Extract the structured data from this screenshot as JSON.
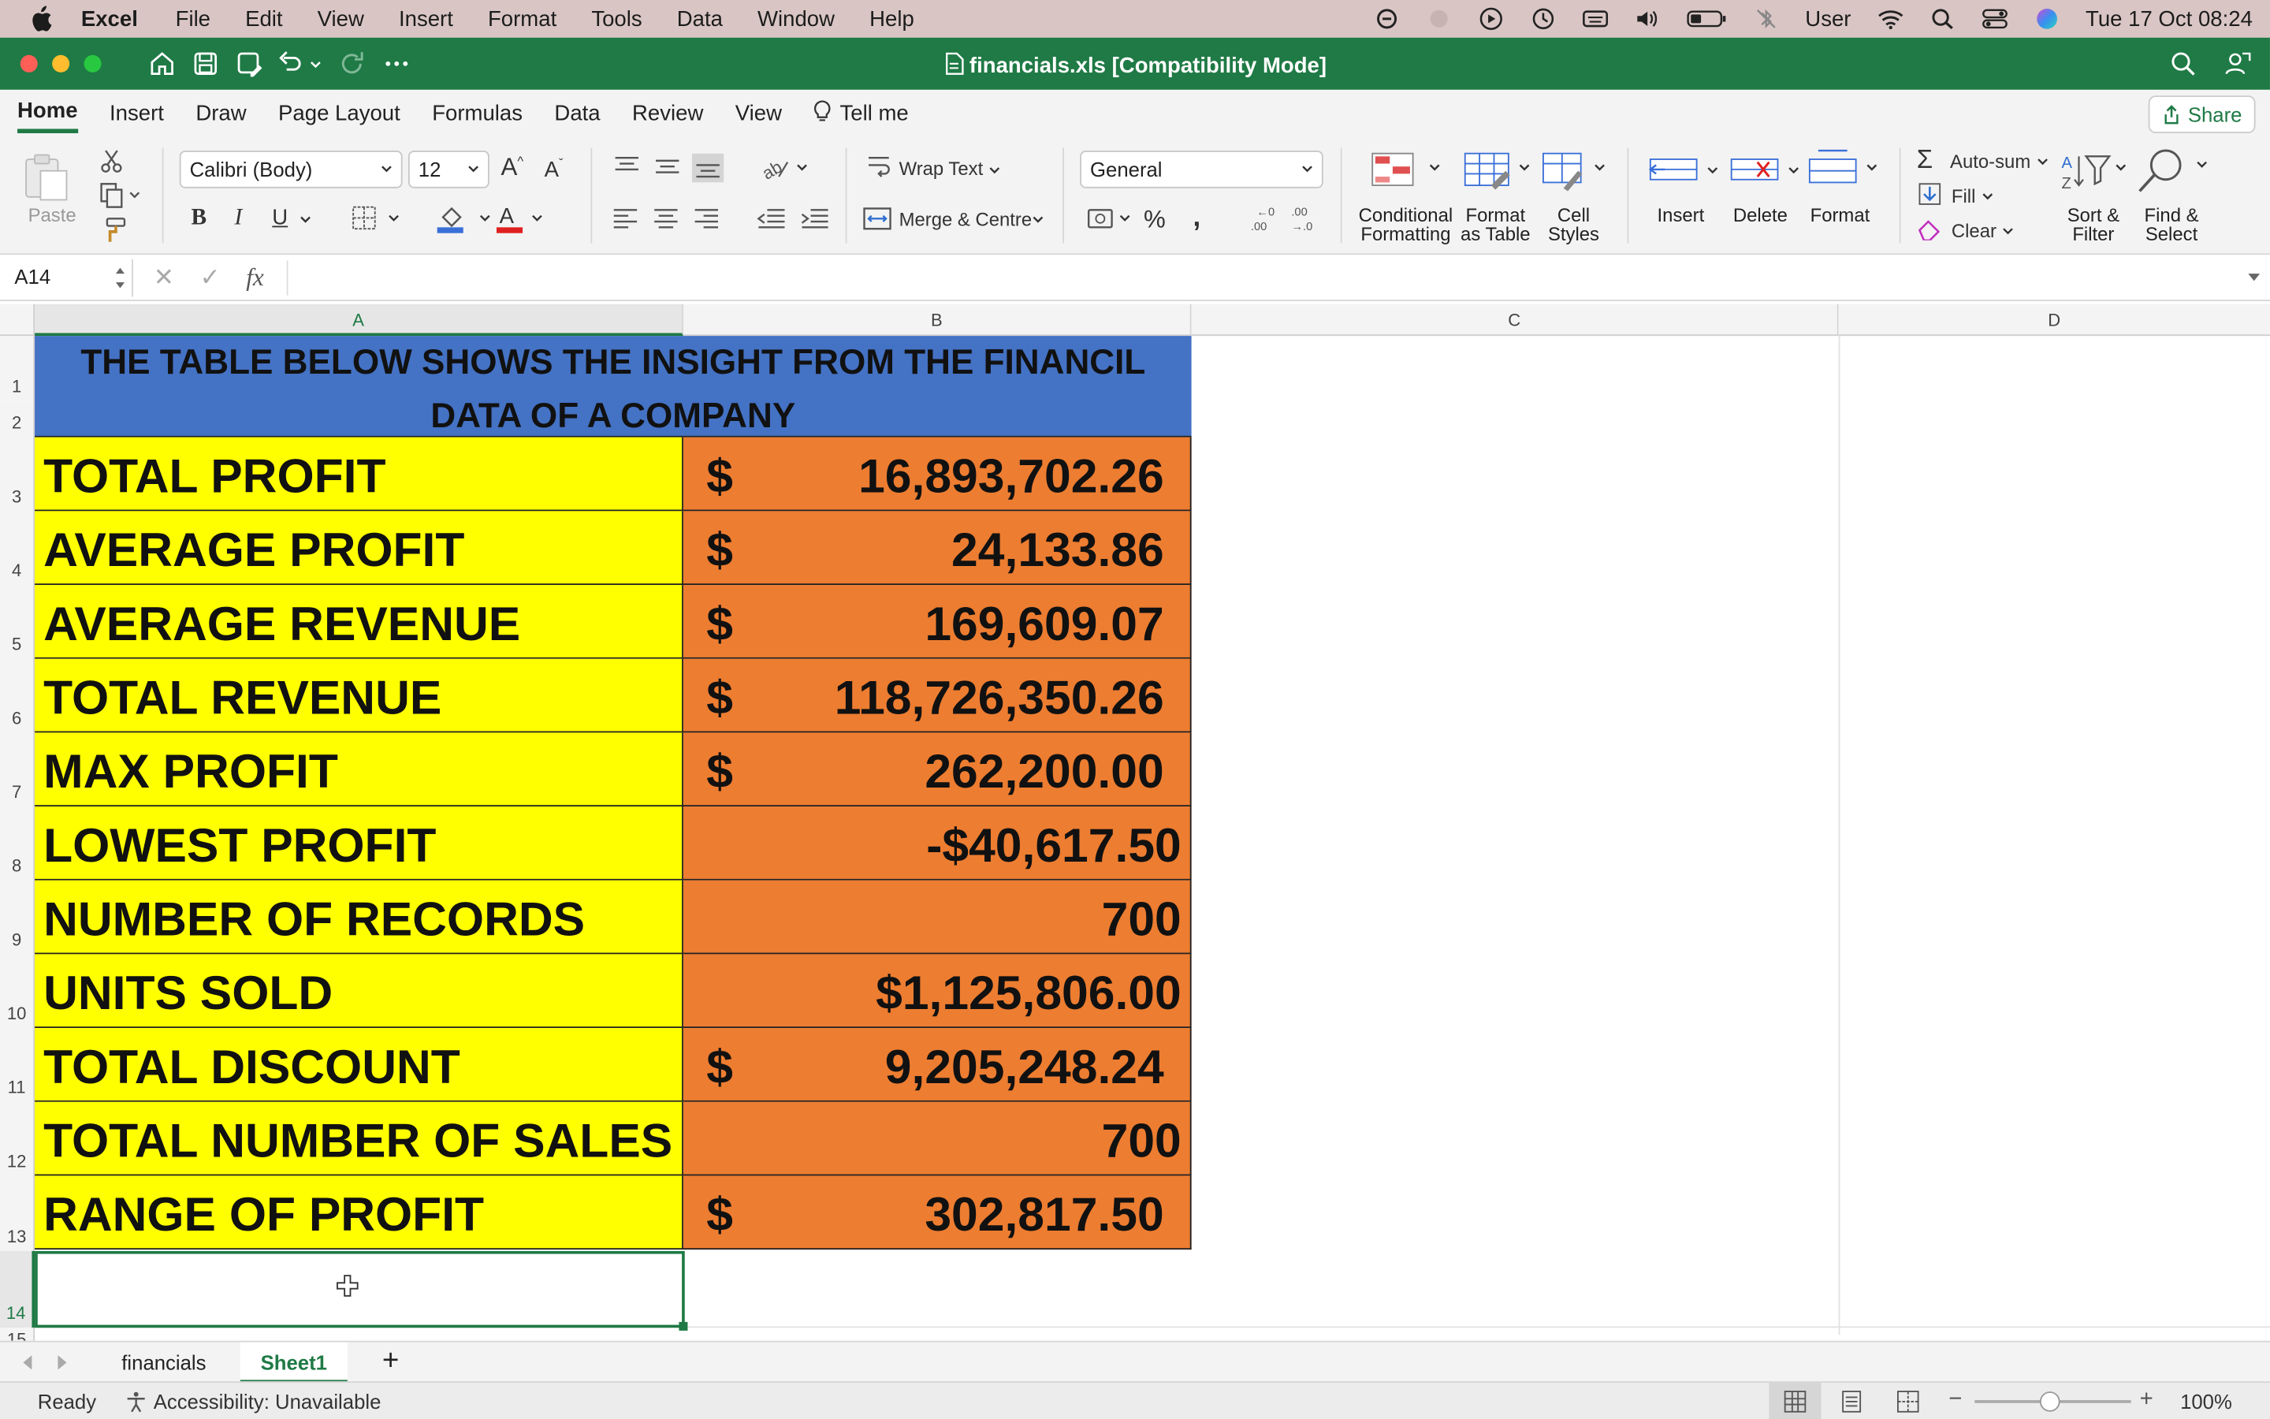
{
  "menubar": {
    "app": "Excel",
    "items": [
      "File",
      "Edit",
      "View",
      "Insert",
      "Format",
      "Tools",
      "Data",
      "Window",
      "Help"
    ],
    "user": "User",
    "datetime": "Tue 17 Oct  08:24"
  },
  "window": {
    "title": "financials.xls  [Compatibility Mode]"
  },
  "ribbon_tabs": [
    "Home",
    "Insert",
    "Draw",
    "Page Layout",
    "Formulas",
    "Data",
    "Review",
    "View"
  ],
  "tell_me": "Tell me",
  "share": "Share",
  "ribbon": {
    "paste": "Paste",
    "font_name": "Calibri (Body)",
    "font_size": "12",
    "wrap_text": "Wrap Text",
    "merge_centre": "Merge & Centre",
    "number_format": "General",
    "conditional_formatting": [
      "Conditional",
      "Formatting"
    ],
    "format_as_table": [
      "Format",
      "as Table"
    ],
    "cell_styles": [
      "Cell",
      "Styles"
    ],
    "insert": "Insert",
    "delete": "Delete",
    "format": "Format",
    "autosum": "Auto-sum",
    "fill": "Fill",
    "clear": "Clear",
    "sort_filter": [
      "Sort &",
      "Filter"
    ],
    "find_select": [
      "Find &",
      "Select"
    ]
  },
  "formula_bar": {
    "name_box": "A14",
    "fx": "fx",
    "content": ""
  },
  "columns": [
    "A",
    "B",
    "C",
    "D"
  ],
  "rows": [
    "1",
    "2",
    "3",
    "4",
    "5",
    "6",
    "7",
    "8",
    "9",
    "10",
    "11",
    "12",
    "13",
    "14",
    "15"
  ],
  "sheet": {
    "banner_line1": "THE TABLE BELOW SHOWS THE INSIGHT FROM THE FINANCIL",
    "banner_line2": "DATA OF A COMPANY",
    "rows": [
      {
        "label": "TOTAL PROFIT",
        "currency": "$",
        "value": "16,893,702.26"
      },
      {
        "label": "AVERAGE PROFIT",
        "currency": "$",
        "value": "24,133.86"
      },
      {
        "label": "AVERAGE REVENUE",
        "currency": "$",
        "value": "169,609.07"
      },
      {
        "label": "TOTAL REVENUE",
        "currency": "$",
        "value": "118,726,350.26"
      },
      {
        "label": "MAX PROFIT",
        "currency": "$",
        "value": "262,200.00"
      },
      {
        "label": "LOWEST PROFIT",
        "currency": "",
        "value": "-$40,617.50"
      },
      {
        "label": "NUMBER OF RECORDS",
        "currency": "",
        "value": "700"
      },
      {
        "label": "UNITS SOLD",
        "currency": "",
        "value": "$1,125,806.00"
      },
      {
        "label": "TOTAL DISCOUNT",
        "currency": "$",
        "value": "9,205,248.24"
      },
      {
        "label": "TOTAL NUMBER OF SALES",
        "currency": "",
        "value": "700"
      },
      {
        "label": "RANGE OF PROFIT",
        "currency": "$",
        "value": "302,817.50"
      }
    ]
  },
  "sheet_tabs": [
    "financials",
    "Sheet1"
  ],
  "status": {
    "ready": "Ready",
    "accessibility": "Accessibility: Unavailable",
    "zoom": "100%"
  },
  "colors": {
    "excel_green": "#1f7a45",
    "banner": "#4472c4",
    "label_fill": "#ffff00",
    "value_fill": "#ed7d31"
  }
}
